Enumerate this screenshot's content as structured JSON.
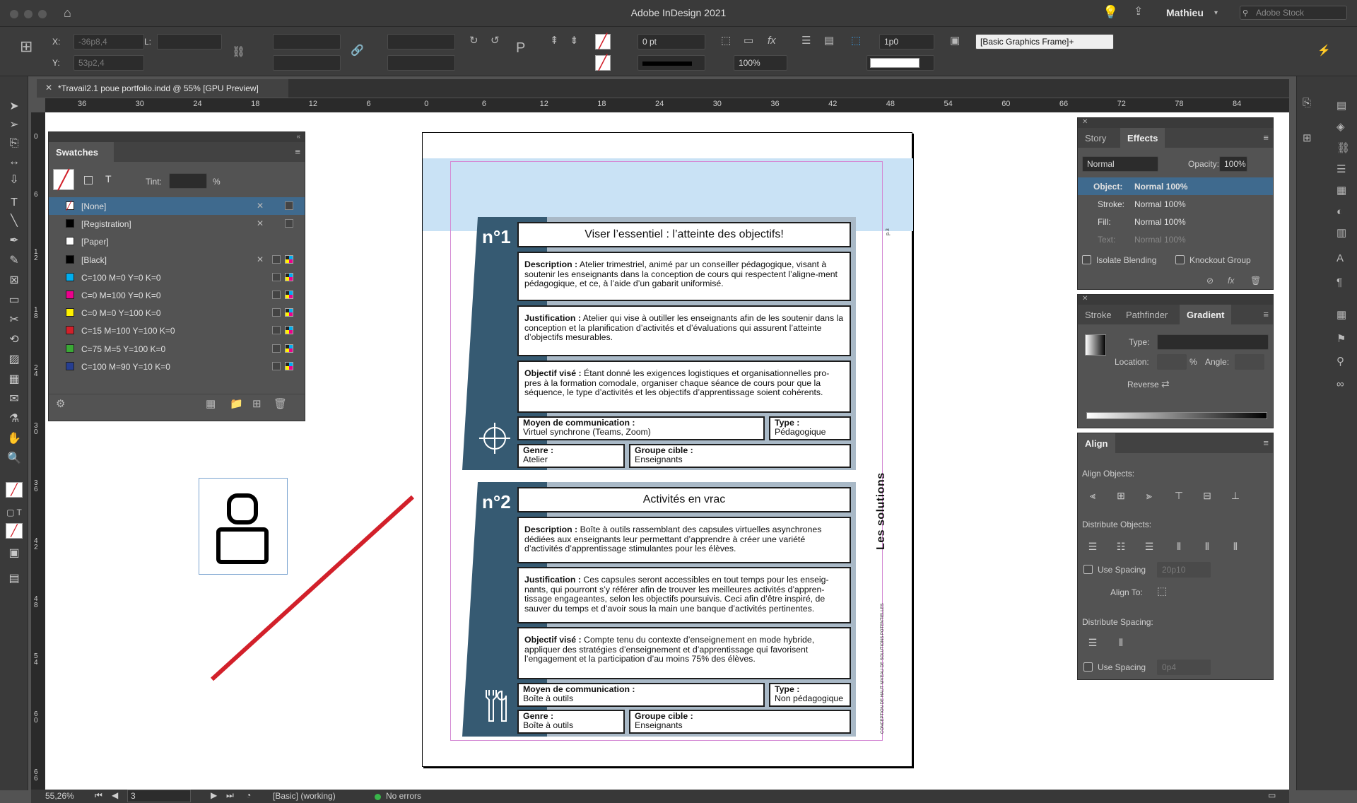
{
  "app": {
    "title": "Adobe InDesign 2021",
    "user": "Mathieu",
    "stock_placeholder": "Adobe Stock"
  },
  "control": {
    "x_label": "X:",
    "x_value": "-36p8,4",
    "y_label": "Y:",
    "y_value": "53p2,4",
    "l_label": "L:",
    "stroke_weight": "0 pt",
    "opacity": "100%",
    "gap": "1p0",
    "object_style": "[Basic Graphics Frame]+"
  },
  "doc_tab": {
    "title": "*Travail2.1 poue portfolio.indd @ 55% [GPU Preview]"
  },
  "rulers": {
    "h_ticks": [
      "36",
      "30",
      "24",
      "18",
      "12",
      "6",
      "0",
      "6",
      "12",
      "18",
      "24",
      "30",
      "36",
      "42",
      "48",
      "54",
      "60",
      "66",
      "72",
      "78",
      "84"
    ],
    "v_ticks": [
      "0",
      "6",
      "1 2",
      "1 8",
      "2 4",
      "3 0",
      "3 6",
      "4 2",
      "4 8",
      "5 4",
      "6 0",
      "6 6"
    ]
  },
  "swatches": {
    "title": "Swatches",
    "tint_label": "Tint:",
    "tint_unit": "%",
    "items": [
      {
        "name": "[None]",
        "color": "none",
        "selected": true
      },
      {
        "name": "[Registration]",
        "color": "#000000"
      },
      {
        "name": "[Paper]",
        "color": "#ffffff"
      },
      {
        "name": "[Black]",
        "color": "#000000"
      },
      {
        "name": "C=100 M=0 Y=0 K=0",
        "color": "#00aeef"
      },
      {
        "name": "C=0 M=100 Y=0 K=0",
        "color": "#ec008c"
      },
      {
        "name": "C=0 M=0 Y=100 K=0",
        "color": "#fff200"
      },
      {
        "name": "C=15 M=100 Y=100 K=0",
        "color": "#d2202a"
      },
      {
        "name": "C=75 M=5 Y=100 K=0",
        "color": "#3aa935"
      },
      {
        "name": "C=100 M=90 Y=10 K=0",
        "color": "#263e91"
      }
    ]
  },
  "effects": {
    "tabs": [
      "Story",
      "Effects"
    ],
    "mode": "Normal",
    "opacity_label": "Opacity:",
    "opacity": "100%",
    "rows": [
      {
        "label": "Object:",
        "value": "Normal 100%"
      },
      {
        "label": "Stroke:",
        "value": "Normal 100%"
      },
      {
        "label": "Fill:",
        "value": "Normal 100%"
      },
      {
        "label": "Text:",
        "value": "Normal 100%"
      }
    ],
    "isolate": "Isolate Blending",
    "knockout": "Knockout Group"
  },
  "gradient": {
    "tabs": [
      "Stroke",
      "Pathfinder",
      "Gradient"
    ],
    "type_label": "Type:",
    "location_label": "Location:",
    "location_unit": "%",
    "angle_label": "Angle:",
    "reverse_label": "Reverse"
  },
  "align": {
    "title": "Align",
    "align_objects": "Align Objects:",
    "distribute_objects": "Distribute Objects:",
    "use_spacing": "Use Spacing",
    "spacing_value": "20p10",
    "align_to": "Align To:",
    "distribute_spacing": "Distribute Spacing:",
    "use_spacing2": "Use Spacing",
    "spacing_value2": "0p4"
  },
  "page": {
    "page_number": "p.3",
    "side_title": "Les solutions",
    "side_tiny": "CONCEPTION DE HAUT NIVEAU DE SOLUTIONS POTENTIELLES",
    "cards": [
      {
        "number": "n°1",
        "title": "Viser l’essentiel : l’atteinte des objectifs!",
        "description_label": "Description :",
        "description": " Atelier trimestriel, animé par un conseiller pédagogique, visant à soutenir les enseignants dans la conception de cours qui respectent l’aligne-ment pédagogique, et ce, à l’aide d’un gabarit uniformisé.",
        "justification_label": "Justification :",
        "justification": " Atelier qui vise à outiller les enseignants afin de les soutenir dans la conception et la planification d’activités et d’évaluations qui assurent l’atteinte d’objectifs mesurables.",
        "objectif_label": "Objectif visé :",
        "objectif": " Étant donné les exigences logistiques et organisationnelles pro-pres à la formation comodale, organiser chaque séance de cours pour que la séquence, le type d’activités et les objectifs d’apprentissage soient cohérents.",
        "moyen_label": "Moyen de communication :",
        "moyen": "Virtuel synchrone (Teams, Zoom)",
        "type_label": "Type :",
        "type": "Pédagogique",
        "genre_label": "Genre :",
        "genre": "Atelier",
        "groupe_label": "Groupe cible :",
        "groupe": "Enseignants"
      },
      {
        "number": "n°2",
        "title": "Activités en vrac",
        "description_label": "Description :",
        "description": " Boîte à outils rassemblant des capsules virtuelles asynchrones dédiées aux enseignants leur permettant d’apprendre à créer une variété d’activités d’apprentissage stimulantes pour les élèves.",
        "justification_label": "Justification :",
        "justification": " Ces capsules seront accessibles en tout temps pour les enseig-nants, qui pourront s’y référer afin de trouver les meilleures activités d’appren-tissage engageantes, selon les objectifs poursuivis. Ceci afin d’être inspiré, de sauver du temps et d’avoir sous la main une banque d’activités pertinentes.",
        "objectif_label": "Objectif visé :",
        "objectif": " Compte tenu du contexte d’enseignement en mode hybride, appliquer des stratégies d’enseignement et d’apprentissage qui favorisent l’engagement et la participation d’au moins 75% des élèves.",
        "moyen_label": "Moyen de communication :",
        "moyen": "Boîte à outils",
        "type_label": "Type :",
        "type": "Non pédagogique",
        "genre_label": "Genre :",
        "genre": "Boîte à outils",
        "groupe_label": "Groupe cible :",
        "groupe": "Enseignants"
      }
    ]
  },
  "status": {
    "zoom": "55,26%",
    "page": "3",
    "profile": "[Basic] (working)",
    "errors": "No errors"
  },
  "colors": {
    "accent": "#365a72",
    "card_bg": "#a9b9c7",
    "band": "#c9e2f5",
    "red_line": "#d2202a",
    "selection": "#3f6a8e"
  }
}
